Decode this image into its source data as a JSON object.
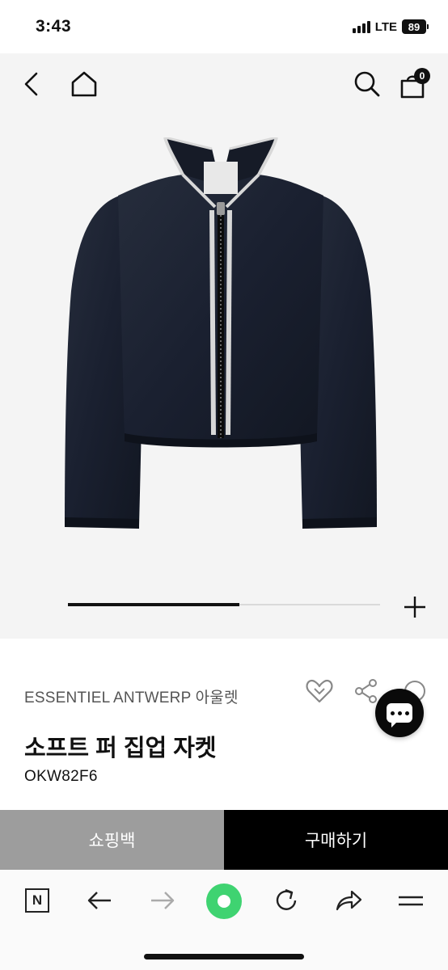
{
  "status_bar": {
    "time": "3:43",
    "network": "LTE",
    "battery": "89"
  },
  "header": {
    "cart_count": "0",
    "icons": [
      "back-icon",
      "home-icon",
      "search-icon",
      "shopping-bag-icon"
    ]
  },
  "gallery": {
    "progress": 0.55,
    "jacket_color": "#1c2230",
    "trim_color": "#d8d8d8"
  },
  "product": {
    "brand": "ESSENTIEL ANTWERP 아울렛",
    "name": "소프트 퍼 집업 자켓",
    "code": "OKW82F6"
  },
  "actions": {
    "cart_label": "쇼핑백",
    "buy_label": "구매하기"
  },
  "browser_toolbar": {
    "naver_label": "N",
    "icons": [
      "naver-icon",
      "back-arrow-icon",
      "forward-arrow-icon",
      "green-dot-icon",
      "reload-icon",
      "share-arrow-icon",
      "menu-icon"
    ]
  },
  "colors": {
    "accent_green": "#3fd371",
    "cart_button": "#9d9d9d",
    "buy_button": "#000000"
  }
}
